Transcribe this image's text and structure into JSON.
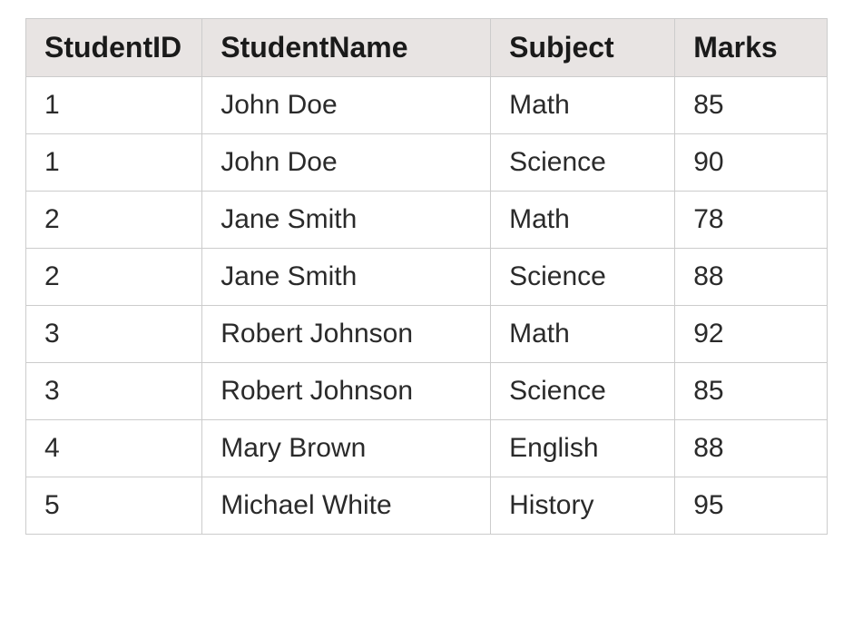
{
  "chart_data": {
    "type": "table",
    "headers": [
      "StudentID",
      "StudentName",
      "Subject",
      "Marks"
    ],
    "rows": [
      {
        "StudentID": "1",
        "StudentName": "John Doe",
        "Subject": "Math",
        "Marks": "85"
      },
      {
        "StudentID": "1",
        "StudentName": "John Doe",
        "Subject": "Science",
        "Marks": "90"
      },
      {
        "StudentID": "2",
        "StudentName": "Jane Smith",
        "Subject": "Math",
        "Marks": "78"
      },
      {
        "StudentID": "2",
        "StudentName": "Jane Smith",
        "Subject": "Science",
        "Marks": "88"
      },
      {
        "StudentID": "3",
        "StudentName": "Robert Johnson",
        "Subject": "Math",
        "Marks": "92"
      },
      {
        "StudentID": "3",
        "StudentName": "Robert Johnson",
        "Subject": "Science",
        "Marks": "85"
      },
      {
        "StudentID": "4",
        "StudentName": "Mary Brown",
        "Subject": "English",
        "Marks": "88"
      },
      {
        "StudentID": "5",
        "StudentName": "Michael White",
        "Subject": "History",
        "Marks": "95"
      }
    ]
  }
}
